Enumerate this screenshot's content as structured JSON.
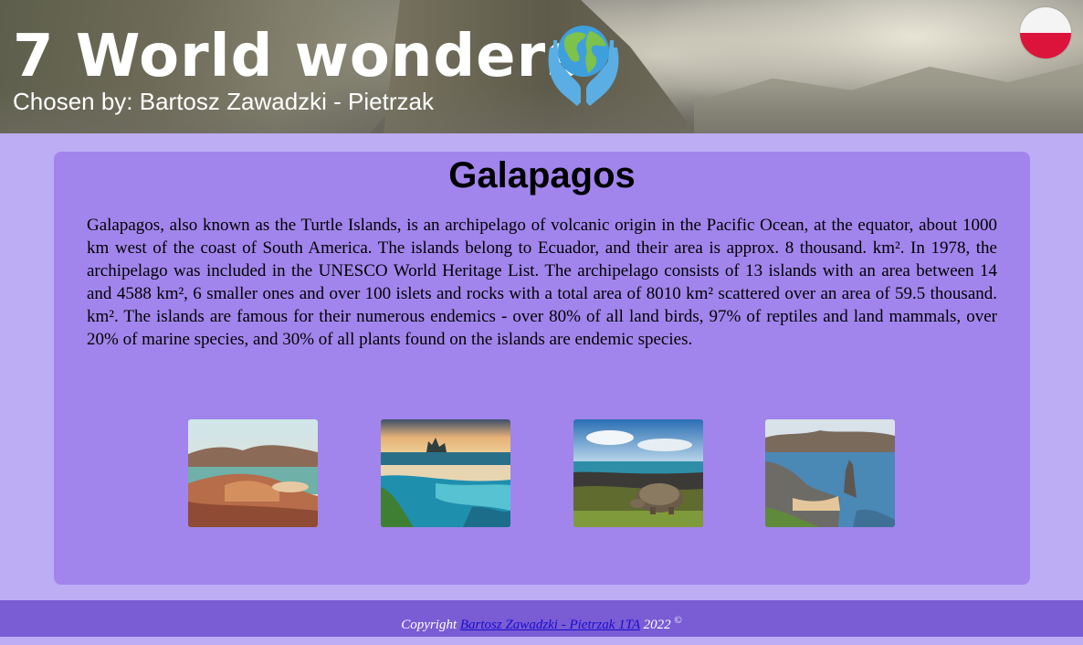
{
  "header": {
    "title": "7 World wonders",
    "subtitle": "Chosen by: Bartosz Zawadzki - Pietrzak",
    "icon": "globe-in-hands-icon",
    "language_flag": "polish-flag-icon"
  },
  "main": {
    "heading": "Galapagos",
    "description": "Galapagos, also known as the Turtle Islands, is an archipelago of volcanic origin in the Pacific Ocean, at the equator, about 1000 km west of the coast of South America. The islands belong to Ecuador, and their area is approx. 8 thousand. km². In 1978, the archipelago was included in the UNESCO World Heritage List. The archipelago consists of 13 islands with an area between 14 and 4588 km², 6 smaller ones and over 100 islets and rocks with a total area of 8010 km² scattered over an area of 59.5 thousand. km². The islands are famous for their numerous endemics - over 80% of all land birds, 97% of reptiles and land mammals, over 20% of marine species, and 30% of all plants found on the islands are endemic species.",
    "gallery": [
      "bay-landscape-photo",
      "beach-lagoon-photo",
      "giant-tortoise-photo",
      "pinnacle-rock-photo"
    ]
  },
  "footer": {
    "prefix": "Copyright",
    "author_link": "Bartosz Zawadzki - Pietrzak 1TA",
    "year": "2022",
    "symbol": "©"
  },
  "colors": {
    "page_bg": "#bdadf5",
    "card_bg": "#a185ec",
    "footer_bg": "#7a5cd5",
    "link": "#1a0dcc"
  }
}
